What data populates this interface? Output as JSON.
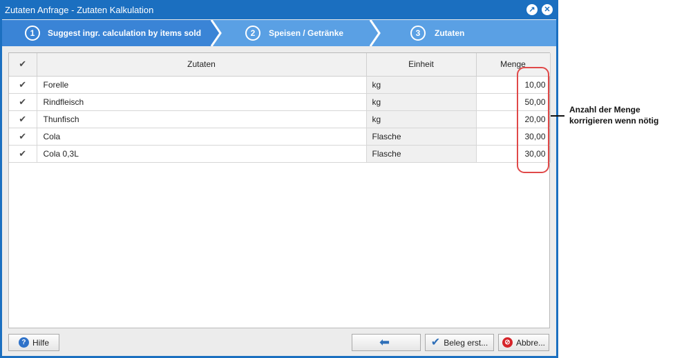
{
  "window": {
    "title": "Zutaten Anfrage - Zutaten Kalkulation"
  },
  "icons": {
    "restore": "restore-icon",
    "close": "close-icon"
  },
  "wizard": {
    "steps": [
      {
        "number": "1",
        "label": "Suggest ingr. calculation by items sold",
        "active": true
      },
      {
        "number": "2",
        "label": "Speisen / Getränke",
        "active": false
      },
      {
        "number": "3",
        "label": "Zutaten",
        "active": false
      }
    ]
  },
  "table": {
    "columns": {
      "zutaten": "Zutaten",
      "einheit": "Einheit",
      "menge": "Menge"
    },
    "rows": [
      {
        "checked": true,
        "name": "Forelle",
        "unit": "kg",
        "qty": "10,00"
      },
      {
        "checked": true,
        "name": "Rindfleisch",
        "unit": "kg",
        "qty": "50,00"
      },
      {
        "checked": true,
        "name": "Thunfisch",
        "unit": "kg",
        "qty": "20,00"
      },
      {
        "checked": true,
        "name": "Cola",
        "unit": "Flasche",
        "qty": "30,00"
      },
      {
        "checked": true,
        "name": "Cola 0,3L",
        "unit": "Flasche",
        "qty": "30,00"
      }
    ]
  },
  "buttons": {
    "help": "Hilfe",
    "back": "",
    "create": "Beleg erst...",
    "cancel": "Abbre..."
  },
  "annotation": {
    "line1": "Anzahl  der Menge",
    "line2": "korrigieren wenn nötig"
  },
  "colors": {
    "window": "#1b6fc0",
    "step_active": "#3a84d6",
    "step_inactive": "#5aa0e4",
    "highlight": "#e04848"
  }
}
